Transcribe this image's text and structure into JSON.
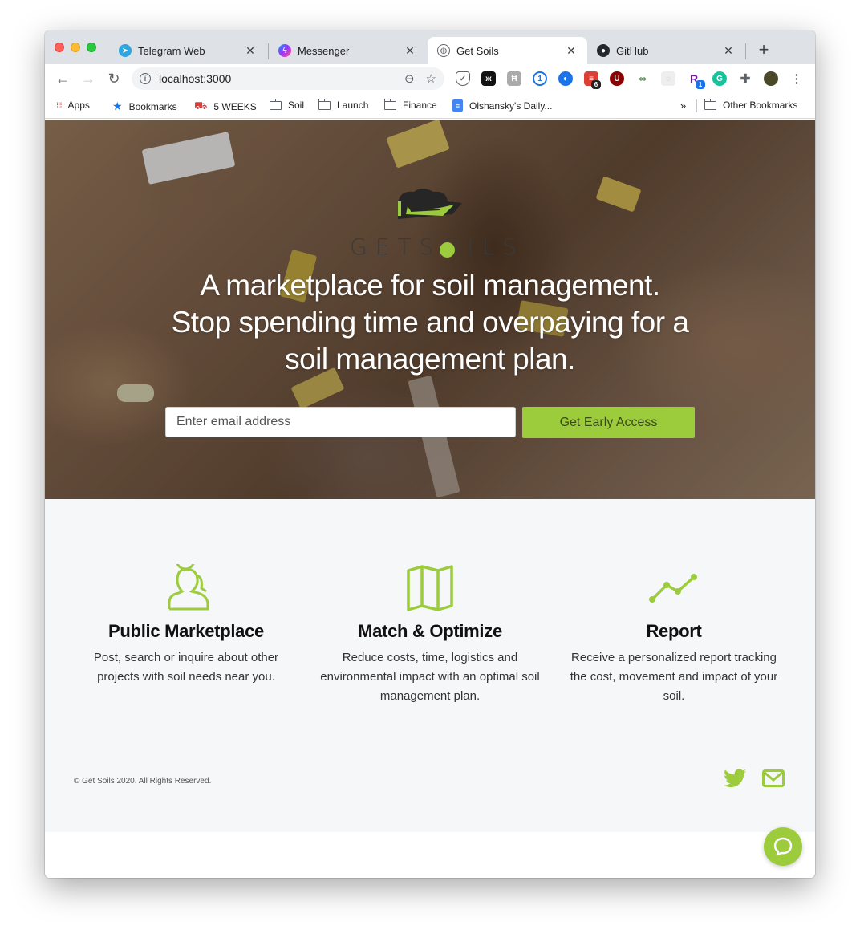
{
  "browser": {
    "tabs": [
      {
        "title": "Telegram Web",
        "icon": "telegram-icon"
      },
      {
        "title": "Messenger",
        "icon": "messenger-icon"
      },
      {
        "title": "Get Soils",
        "icon": "globe-icon",
        "active": true
      },
      {
        "title": "GitHub",
        "icon": "github-icon"
      }
    ],
    "url": "localhost:3000",
    "extension_badges": {
      "todoist": "6",
      "reader": "1"
    },
    "bookmarks": [
      {
        "label": "Apps",
        "icon": "apps-grid-icon"
      },
      {
        "label": "Bookmarks",
        "icon": "star-icon"
      },
      {
        "label": "5 WEEKS",
        "icon": "5weeks-icon"
      },
      {
        "label": "Soil",
        "icon": "folder-icon"
      },
      {
        "label": "Launch",
        "icon": "folder-icon"
      },
      {
        "label": "Finance",
        "icon": "folder-icon"
      },
      {
        "label": "Olshansky's Daily...",
        "icon": "doc-icon"
      }
    ],
    "overflow_label": "»",
    "other_bookmarks": "Other Bookmarks"
  },
  "hero": {
    "logo_text": "GETSOILS",
    "headline_line1": "A marketplace for soil management.",
    "headline_line2": "Stop spending time and overpaying for a",
    "headline_line3": "soil management plan.",
    "email_placeholder": "Enter email address",
    "cta_label": "Get Early Access"
  },
  "features": [
    {
      "title": "Public Marketplace",
      "description": "Post, search or inquire about other projects with soil needs near you.",
      "icon": "users-icon"
    },
    {
      "title": "Match & Optimize",
      "description": "Reduce costs, time, logistics and environmental impact with an optimal soil management plan.",
      "icon": "map-icon"
    },
    {
      "title": "Report",
      "description": "Receive a personalized report tracking the cost, movement and impact of your soil.",
      "icon": "trend-line-icon"
    }
  ],
  "footer": {
    "copyright": "© Get Soils 2020. All Rights Reserved."
  },
  "colors": {
    "accent": "#9ccc3c",
    "features_bg": "#f6f7f9"
  }
}
